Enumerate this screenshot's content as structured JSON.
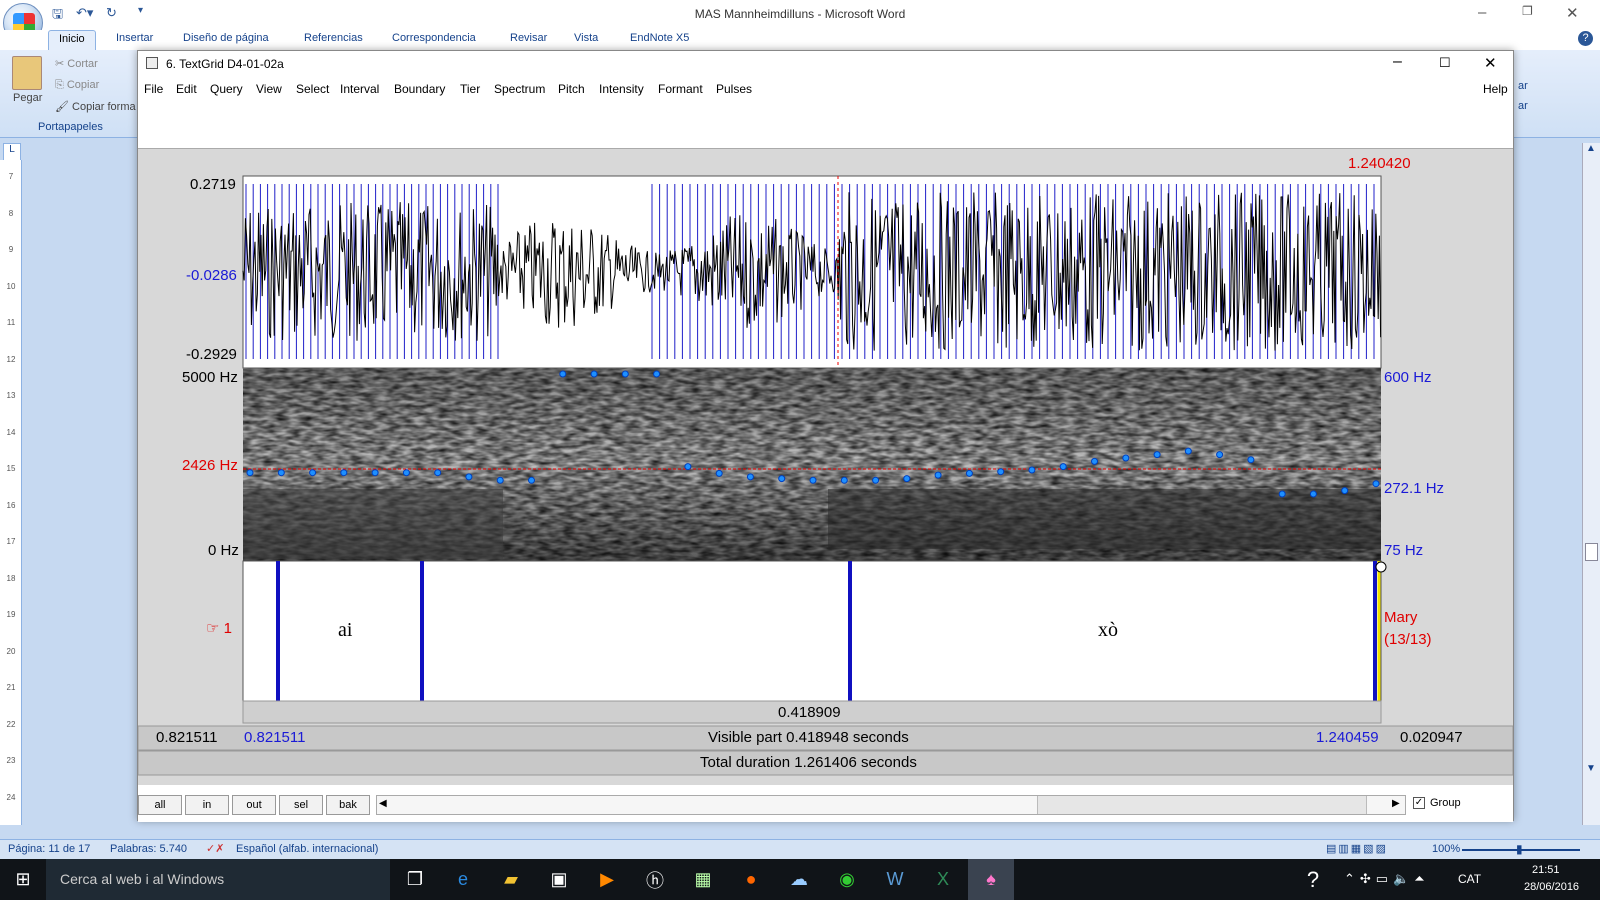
{
  "word": {
    "title": "MAS Mannheimdilluns - Microsoft Word",
    "tabs": [
      "Inicio",
      "Insertar",
      "Diseño de página",
      "Referencias",
      "Correspondencia",
      "Revisar",
      "Vista",
      "EndNote X5"
    ],
    "clipboard": {
      "paste": "Pegar",
      "cut": "Cortar",
      "copy": "Copiar",
      "format": "Copiar forma",
      "group": "Portapapeles"
    },
    "ribbon_right": [
      "ar",
      "ar"
    ],
    "status": {
      "page": "Página: 11 de 17",
      "words": "Palabras: 5.740",
      "language": "Español (alfab. internacional)",
      "zoom": "100%"
    }
  },
  "praat": {
    "title": "6. TextGrid D4-01-02a",
    "menu": [
      "File",
      "Edit",
      "Query",
      "View",
      "Select",
      "Interval",
      "Boundary",
      "Tier",
      "Spectrum",
      "Pitch",
      "Intensity",
      "Formant",
      "Pulses"
    ],
    "help": "Help",
    "cursor_time": "1.240420",
    "wave": {
      "max": "0.2719",
      "mid": "-0.0286",
      "min": "-0.2929"
    },
    "spectro": {
      "top": "5000 Hz",
      "cursor": "2426 Hz",
      "bottom": "0 Hz"
    },
    "pitch": {
      "top": "600 Hz",
      "mid": "272.1 Hz",
      "bottom": "75 Hz"
    },
    "tier": {
      "number": "1",
      "name": "Mary",
      "count": "(13/13)",
      "labels": [
        "ai",
        "xò"
      ]
    },
    "selection_duration": "0.418909",
    "left_time": "0.821511",
    "visible_start": "0.821511",
    "visible_part": "Visible part 0.418948 seconds",
    "visible_end": "1.240459",
    "right_time": "0.020947",
    "total_duration": "Total duration 1.261406 seconds",
    "buttons": [
      "all",
      "in",
      "out",
      "sel",
      "bak"
    ],
    "group_label": "Group",
    "pitch_points": [
      312,
      312,
      312,
      312,
      312,
      312,
      312,
      300,
      290,
      290,
      600,
      600,
      600,
      600,
      330,
      310,
      300,
      295,
      290,
      290,
      290,
      295,
      305,
      310,
      315,
      320,
      330,
      345,
      355,
      365,
      375,
      365,
      350,
      250,
      250,
      260,
      280
    ]
  },
  "taskbar": {
    "search": "Cerca al web i al Windows",
    "lang": "CAT",
    "time": "21:51",
    "date": "28/06/2016"
  }
}
